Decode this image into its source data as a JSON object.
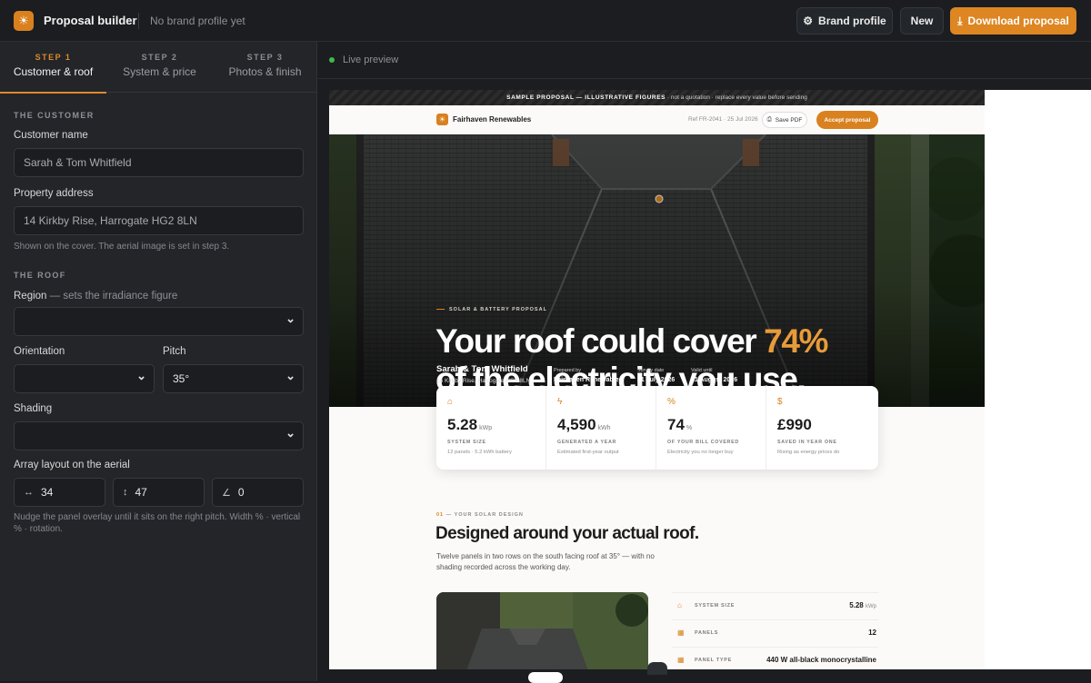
{
  "topbar": {
    "title": "Proposal builder",
    "brand_status": "No brand profile yet",
    "brand_profile_label": "Brand profile",
    "new_label": "New",
    "download_label": "Download proposal"
  },
  "steps": [
    {
      "num": "STEP 1",
      "label": "Customer & roof",
      "active": true
    },
    {
      "num": "STEP 2",
      "label": "System & price",
      "active": false
    },
    {
      "num": "STEP 3",
      "label": "Photos & finish",
      "active": false
    }
  ],
  "form": {
    "customer_heading": "THE CUSTOMER",
    "customer_name_label": "Customer name",
    "customer_name_value": "Sarah & Tom Whitfield",
    "address_label": "Property address",
    "address_value": "14 Kirkby Rise, Harrogate HG2 8LN",
    "address_help": "Shown on the cover. The aerial image is set in step 3.",
    "roof_heading": "THE ROOF",
    "region_label": "Region",
    "region_sub": "— sets the irradiance figure",
    "region_value": "",
    "orientation_label": "Orientation",
    "orientation_value": "",
    "pitch_label": "Pitch",
    "pitch_value": "35°",
    "shading_label": "Shading",
    "shading_value": "",
    "array_label": "Array layout on the aerial",
    "array_width": "34",
    "array_vertical": "47",
    "array_rotation": "0",
    "array_help": "Nudge the panel overlay until it sits on the right pitch. Width % · vertical % · rotation."
  },
  "preview": {
    "live_label": "Live preview",
    "banner_strong": "SAMPLE PROPOSAL — ILLUSTRATIVE FIGURES",
    "banner_rest": " · not a quotation · replace every value before sending",
    "company": "Fairhaven Renewables",
    "ref": "Ref FR-2041 · 25 Jul 2026",
    "save_pdf": "Save PDF",
    "accept": "Accept proposal",
    "eyebrow": "SOLAR & BATTERY PROPOSAL",
    "headline_1": "Your roof could cover ",
    "headline_pct": "74%",
    "headline_2": "of the electricity you use.",
    "customer_name": "Sarah & Tom Whitfield",
    "customer_address": "14 Kirkby Rise, Harrogate HG2 8LN",
    "prepared_by_label": "Prepared by",
    "prepared_by": "Fairhaven Renewables",
    "survey_label": "Survey date",
    "survey_date": "21 July 2026",
    "valid_label": "Valid until",
    "valid_date": "21 August 2026",
    "stats": [
      {
        "icon": "house-icon",
        "value": "5.28",
        "unit": "kWp",
        "caption": "SYSTEM SIZE",
        "sub": "12 panels · 5.2 kWh battery"
      },
      {
        "icon": "bolt-icon",
        "value": "4,590",
        "unit": "kWh",
        "caption": "GENERATED A YEAR",
        "sub": "Estimated first-year output"
      },
      {
        "icon": "percent-icon",
        "value": "74",
        "unit": "%",
        "caption": "OF YOUR BILL COVERED",
        "sub": "Electricity you no longer buy"
      },
      {
        "icon": "pound-icon",
        "value": "£990",
        "unit": "",
        "caption": "SAVED IN YEAR ONE",
        "sub": "Rising as energy prices do"
      }
    ],
    "section_num": "01",
    "section_eyebrow": "— YOUR SOLAR DESIGN",
    "section_title": "Designed around your actual roof.",
    "section_text": "Twelve panels in two rows on the south facing roof at 35° — with no shading recorded across the working day.",
    "specs": [
      {
        "key": "SYSTEM SIZE",
        "value": "5.28",
        "unit": "kWp"
      },
      {
        "key": "PANELS",
        "value": "12",
        "unit": ""
      },
      {
        "key": "PANEL TYPE",
        "value": "440 W all-black monocrystalline",
        "unit": ""
      }
    ]
  },
  "colors": {
    "accent": "#dd8622",
    "background": "#1b1d20",
    "sidebar": "#232529",
    "live_dot": "#3fb950"
  }
}
